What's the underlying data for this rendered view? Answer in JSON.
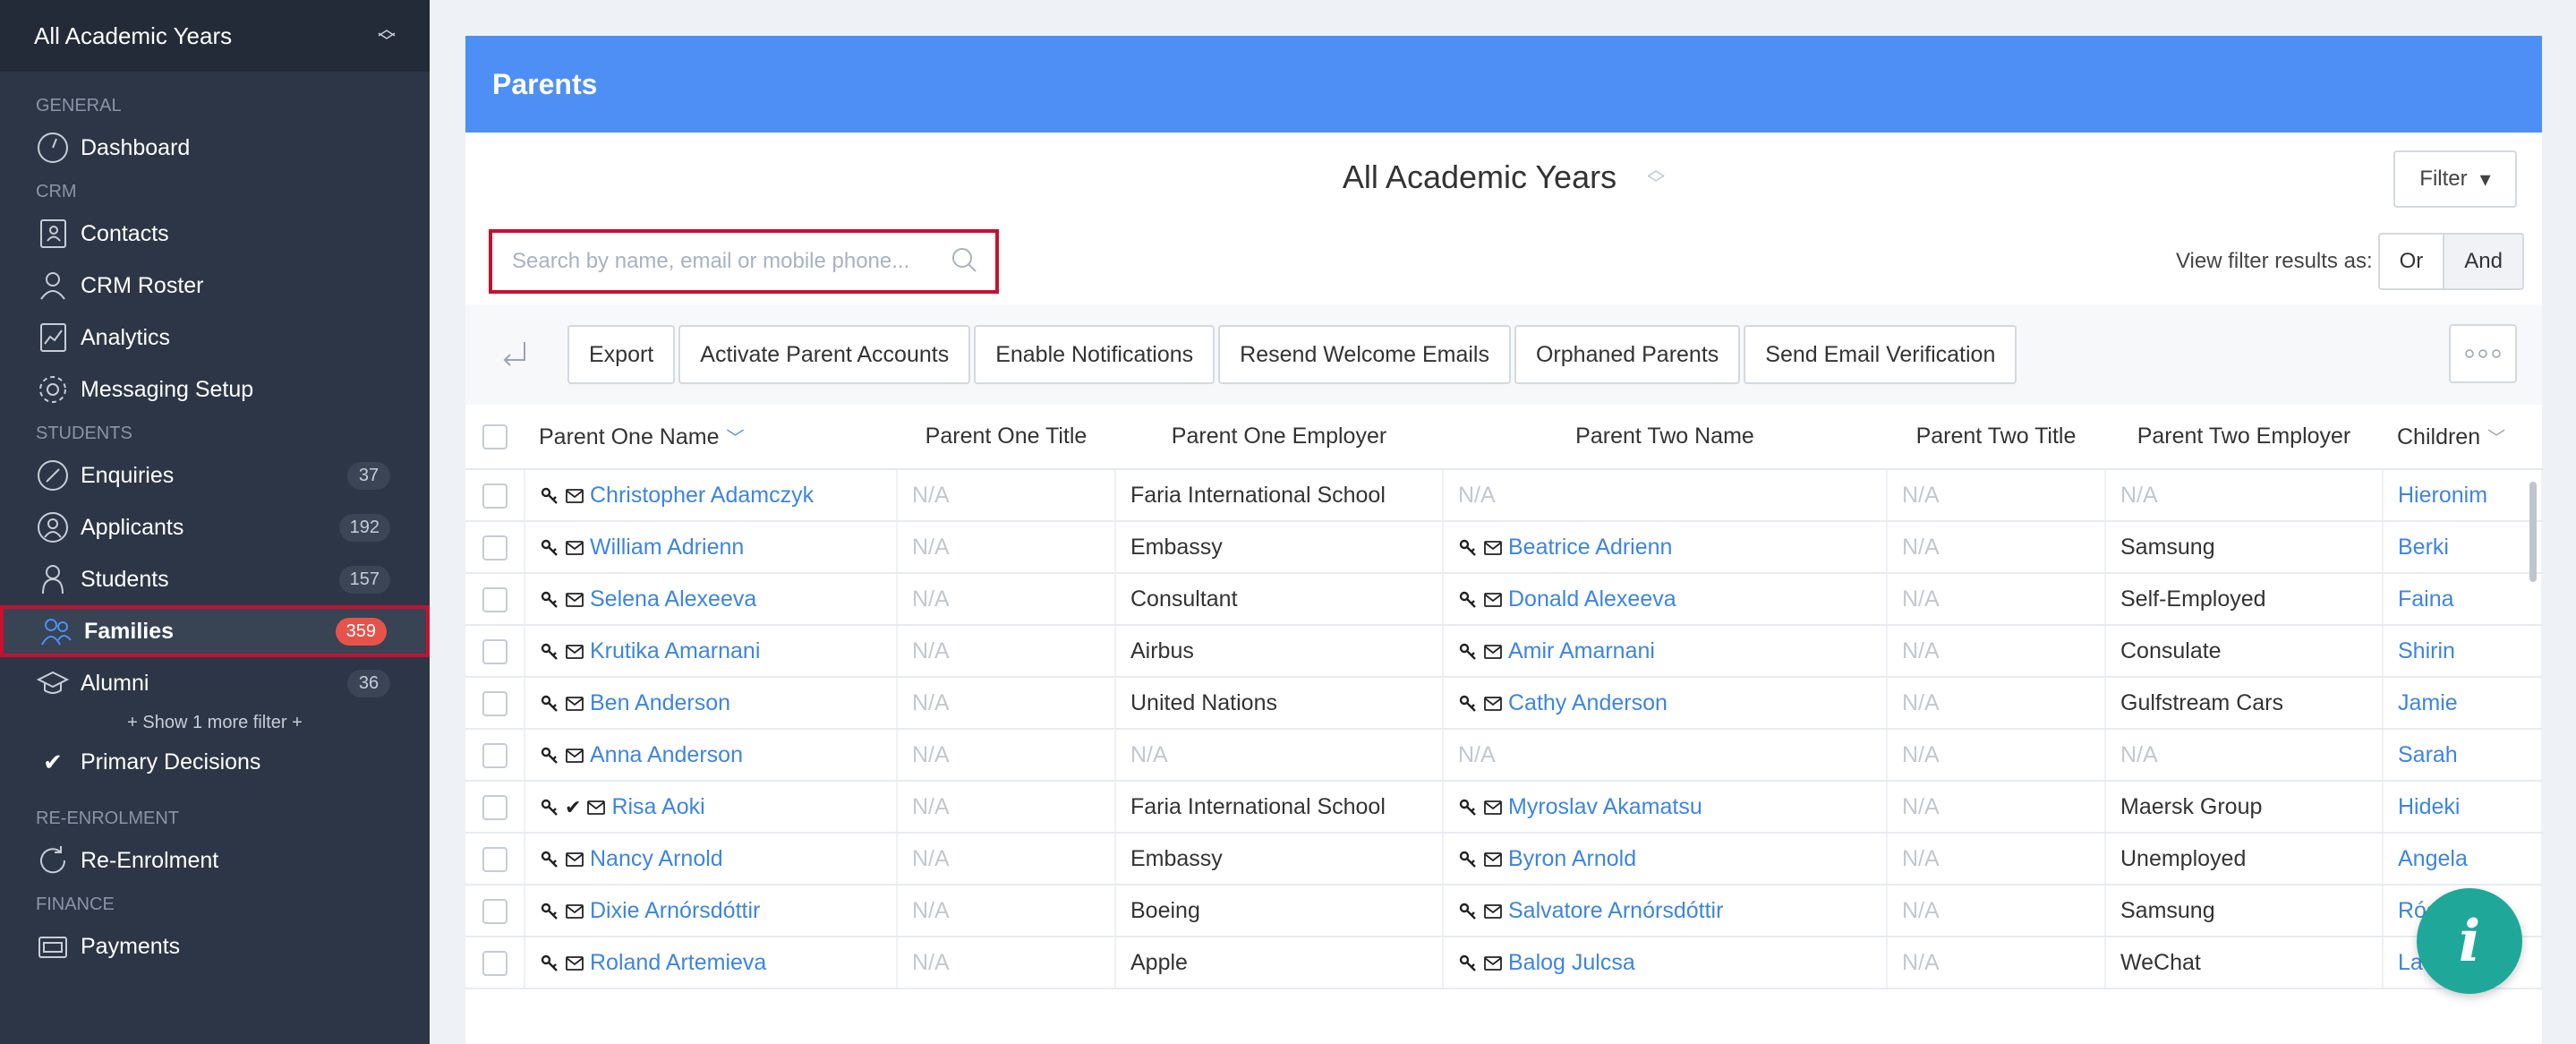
{
  "sidebar": {
    "year_select": "All Academic Years",
    "sections": {
      "general": "GENERAL",
      "crm": "CRM",
      "students": "STUDENTS",
      "reenrolment": "RE-ENROLMENT",
      "finance": "FINANCE"
    },
    "items": {
      "dashboard": "Dashboard",
      "contacts": "Contacts",
      "crm_roster": "CRM Roster",
      "analytics": "Analytics",
      "messaging_setup": "Messaging Setup",
      "enquiries": {
        "label": "Enquiries",
        "count": "37"
      },
      "applicants": {
        "label": "Applicants",
        "count": "192"
      },
      "students": {
        "label": "Students",
        "count": "157"
      },
      "families": {
        "label": "Families",
        "count": "359"
      },
      "alumni": {
        "label": "Alumni",
        "count": "36"
      },
      "show_more": "+ Show 1 more filter +",
      "primary_decisions": "Primary Decisions",
      "reenrolment": "Re-Enrolment",
      "payments": "Payments"
    }
  },
  "panel": {
    "title": "Parents",
    "year_title": "All Academic Years",
    "filter_label": "Filter",
    "search_placeholder": "Search by name, email or mobile phone...",
    "view_as_label": "View filter results as:",
    "view_or": "Or",
    "view_and": "And"
  },
  "toolbar": {
    "buttons": [
      "Export",
      "Activate Parent Accounts",
      "Enable Notifications",
      "Resend Welcome Emails",
      "Orphaned Parents",
      "Send Email Verification"
    ]
  },
  "table": {
    "headers": [
      "Parent One Name",
      "Parent One Title",
      "Parent One Employer",
      "Parent Two Name",
      "Parent Two Title",
      "Parent Two Employer",
      "Children"
    ],
    "rows": [
      {
        "p1": "Christopher Adamczyk",
        "p1_verified": false,
        "p1_title": "N/A",
        "p1_emp": "Faria International School",
        "p2": "N/A",
        "p2_title": "N/A",
        "p2_emp": "N/A",
        "child": "Hieronim"
      },
      {
        "p1": "William Adrienn",
        "p1_verified": false,
        "p1_title": "N/A",
        "p1_emp": "Embassy",
        "p2": "Beatrice Adrienn",
        "p2_title": "N/A",
        "p2_emp": "Samsung",
        "child": "Berki"
      },
      {
        "p1": "Selena Alexeeva",
        "p1_verified": false,
        "p1_title": "N/A",
        "p1_emp": "Consultant",
        "p2": "Donald Alexeeva",
        "p2_title": "N/A",
        "p2_emp": "Self-Employed",
        "child": "Faina"
      },
      {
        "p1": "Krutika Amarnani",
        "p1_verified": false,
        "p1_title": "N/A",
        "p1_emp": "Airbus",
        "p2": "Amir Amarnani",
        "p2_title": "N/A",
        "p2_emp": "Consulate",
        "child": "Shirin"
      },
      {
        "p1": "Ben Anderson",
        "p1_verified": false,
        "p1_title": "N/A",
        "p1_emp": "United Nations",
        "p2": "Cathy Anderson",
        "p2_title": "N/A",
        "p2_emp": "Gulfstream Cars",
        "child": "Jamie"
      },
      {
        "p1": "Anna Anderson",
        "p1_verified": false,
        "p1_title": "N/A",
        "p1_emp": "N/A",
        "p2": "N/A",
        "p2_title": "N/A",
        "p2_emp": "N/A",
        "child": "Sarah"
      },
      {
        "p1": "Risa Aoki",
        "p1_verified": true,
        "p1_title": "N/A",
        "p1_emp": "Faria International School",
        "p2": "Myroslav Akamatsu",
        "p2_title": "N/A",
        "p2_emp": "Maersk Group",
        "child": "Hideki"
      },
      {
        "p1": "Nancy Arnold",
        "p1_verified": false,
        "p1_title": "N/A",
        "p1_emp": "Embassy",
        "p2": "Byron Arnold",
        "p2_title": "N/A",
        "p2_emp": "Unemployed",
        "child": "Angela"
      },
      {
        "p1": "Dixie Arnórsdóttir",
        "p1_verified": false,
        "p1_title": "N/A",
        "p1_emp": "Boeing",
        "p2": "Salvatore Arnórsdóttir",
        "p2_title": "N/A",
        "p2_emp": "Samsung",
        "child": "Rósa"
      },
      {
        "p1": "Roland Artemieva",
        "p1_verified": false,
        "p1_title": "N/A",
        "p1_emp": "Apple",
        "p2": "Balog Julcsa",
        "p2_title": "N/A",
        "p2_emp": "WeChat",
        "child": "Laura"
      }
    ]
  },
  "info_button": "i"
}
